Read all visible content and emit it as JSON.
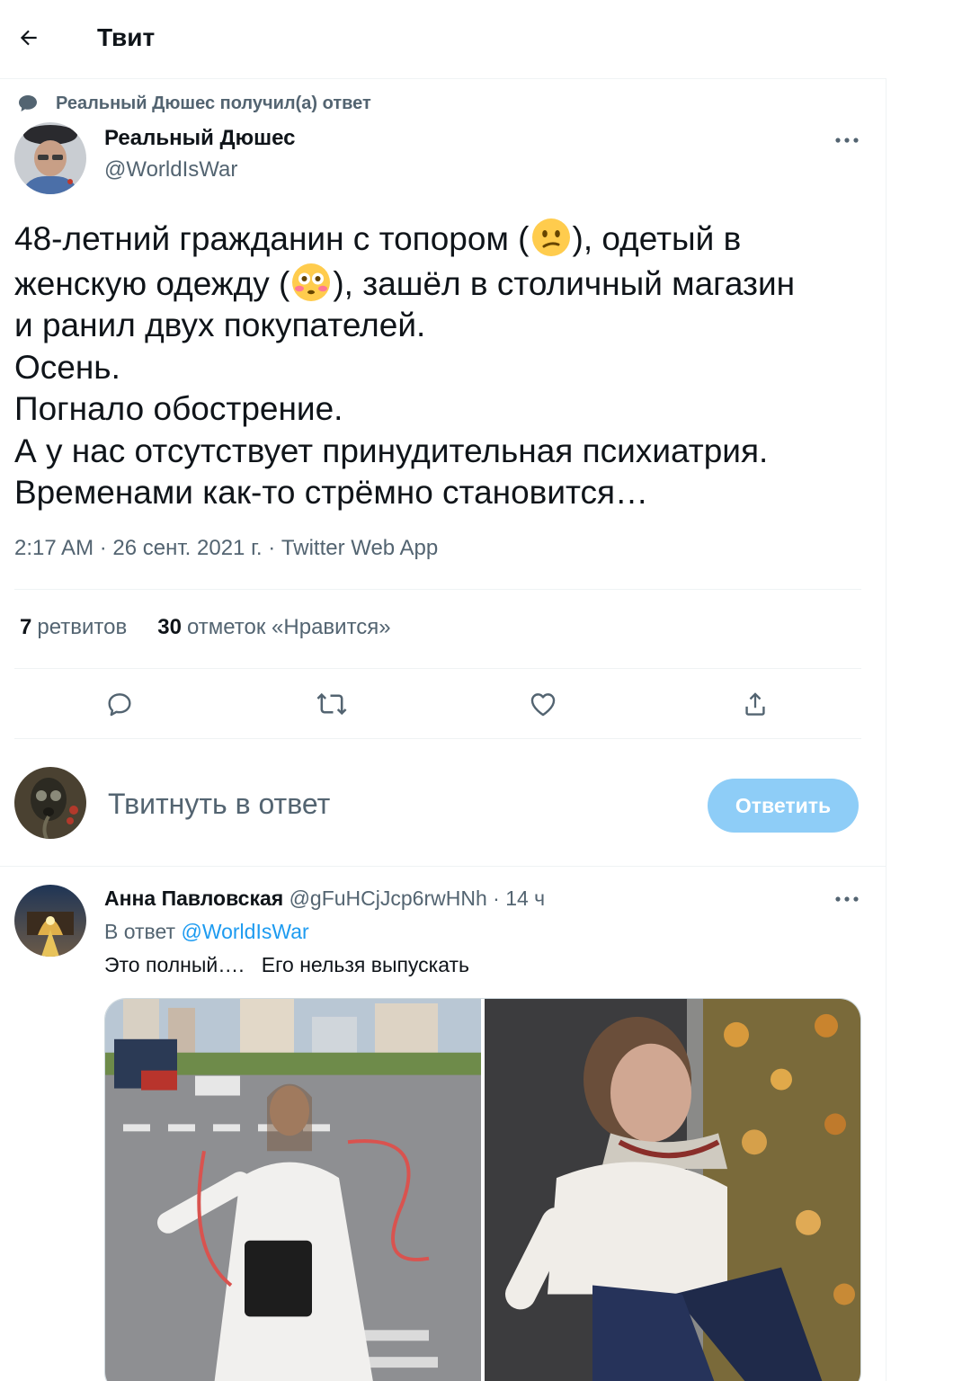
{
  "header": {
    "title": "Твит"
  },
  "social_context": {
    "text": "Реальный Дюшес получил(а) ответ"
  },
  "tweet": {
    "author_name": "Реальный Дюшес",
    "author_handle": "@WorldIsWar",
    "text_lines": [
      [
        "48-летний гражданин с топором (",
        "), одетый в"
      ],
      [
        "женскую одежду (",
        "), зашёл в столичный магазин"
      ],
      "и ранил двух покупателей.",
      "Осень.",
      "Погнало обострение.",
      "А у нас отсутствует принудительная психиатрия.",
      "Временами как-то стрёмно становится…"
    ],
    "emojis": [
      "confused-face",
      "flushed-face"
    ],
    "meta": "2:17 AM · 26 сент. 2021 г. · Twitter Web App",
    "retweets_count": "7",
    "retweets_label": "ретвитов",
    "likes_count": "30",
    "likes_label": "отметок «Нравится»"
  },
  "composer": {
    "placeholder": "Твитнуть в ответ",
    "button_label": "Ответить"
  },
  "reply": {
    "author_name": "Анна Павловская",
    "author_handle_time": "@gFuHCjJcp6rwHNh · 14 ч",
    "reply_to_prefix": "В ответ",
    "reply_to_mention": "@WorldIsWar",
    "text": "Это полный….   Его нельзя выпускать",
    "photos": [
      "street-photo",
      "autumn-leaves-photo"
    ]
  },
  "colors": {
    "accent": "#1d9bf0",
    "button_disabled": "#8ecdf7",
    "secondary_text": "#536471",
    "border": "#eff3f4"
  }
}
